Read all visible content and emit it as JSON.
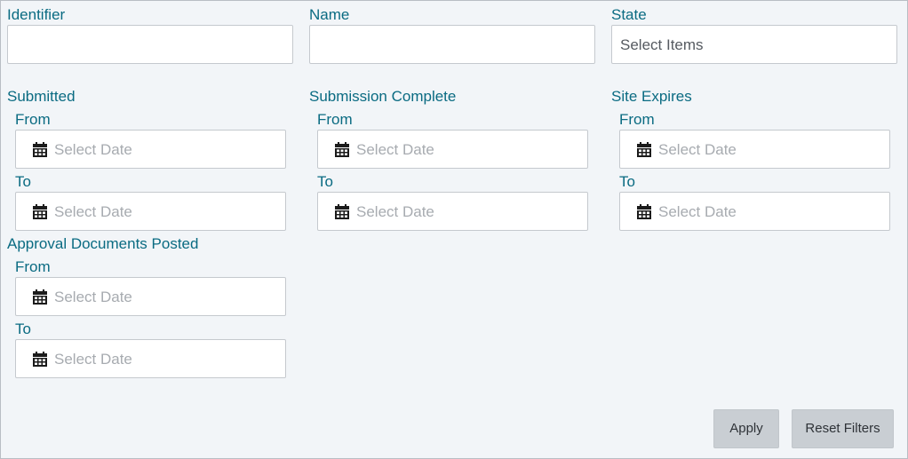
{
  "filters": {
    "identifier": {
      "label": "Identifier",
      "value": ""
    },
    "name": {
      "label": "Name",
      "value": ""
    },
    "state": {
      "label": "State",
      "placeholder": "Select Items"
    }
  },
  "date_groups": {
    "submitted": {
      "label": "Submitted"
    },
    "submission_complete": {
      "label": "Submission Complete"
    },
    "site_expires": {
      "label": "Site Expires"
    },
    "approval_documents_posted": {
      "label": "Approval Documents Posted"
    }
  },
  "range": {
    "from_label": "From",
    "to_label": "To",
    "date_placeholder": "Select Date"
  },
  "icons": {
    "date": "calendar-icon"
  },
  "actions": {
    "apply_label": "Apply",
    "reset_label": "Reset Filters"
  },
  "colors": {
    "label": "#0a6b82",
    "button_bg": "#c9ced3",
    "panel_bg": "#f2f5f8"
  }
}
